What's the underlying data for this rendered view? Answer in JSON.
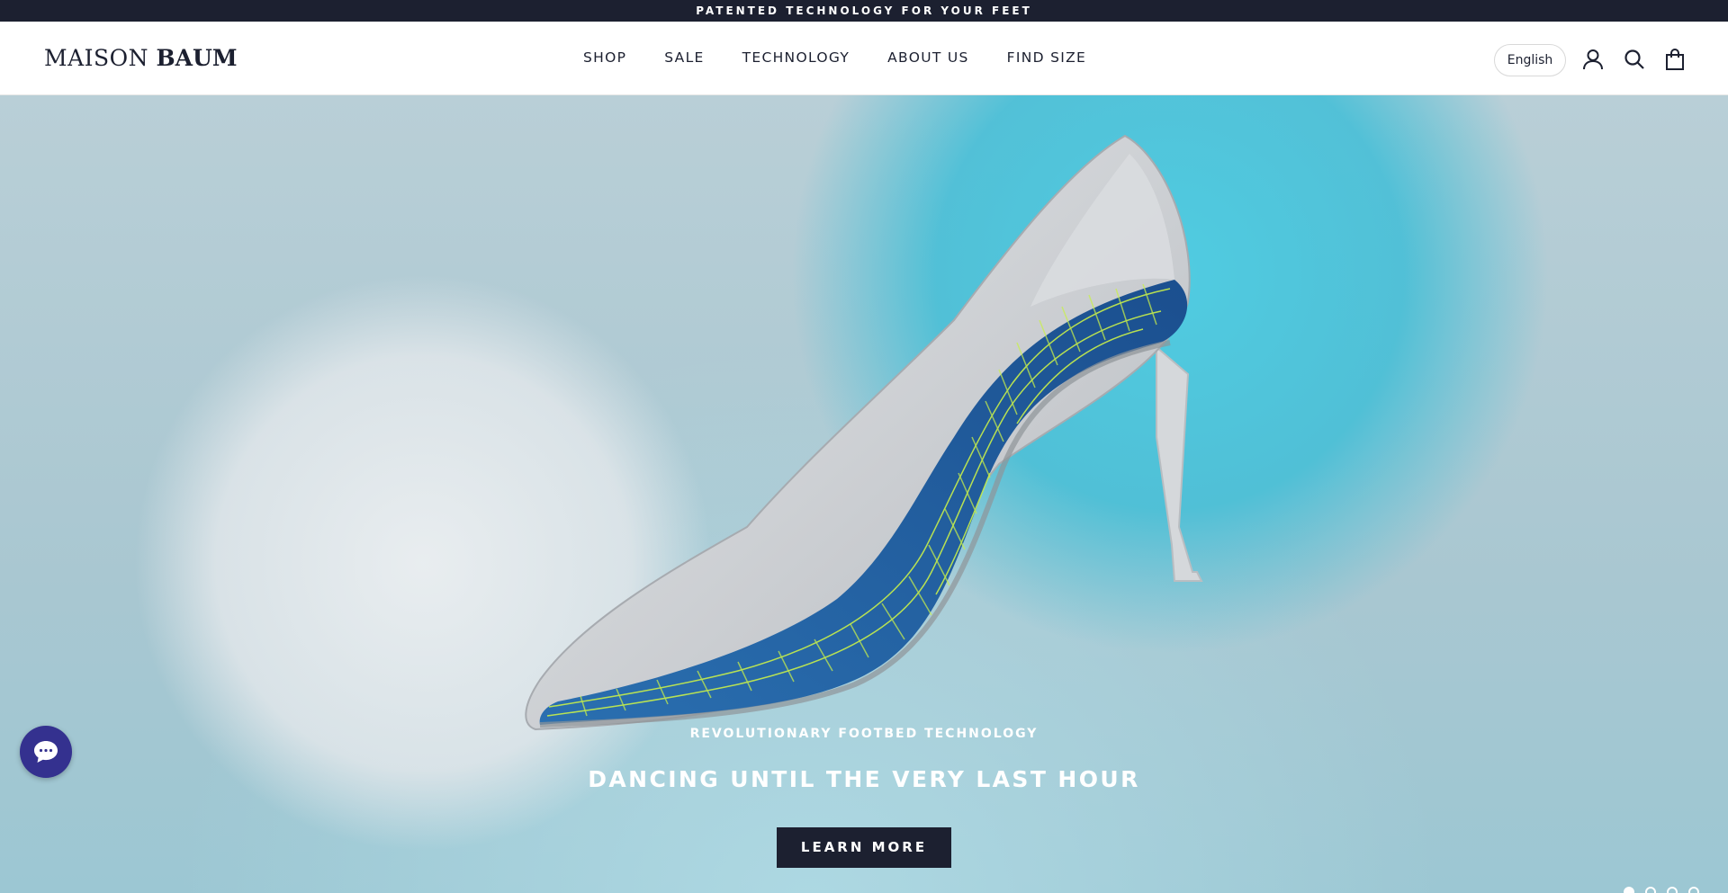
{
  "announcement": "PATENTED TECHNOLOGY FOR YOUR FEET",
  "header": {
    "logo_regular": "MAISON ",
    "logo_bold": "BAUM",
    "nav": [
      {
        "label": "SHOP"
      },
      {
        "label": "SALE"
      },
      {
        "label": "TECHNOLOGY"
      },
      {
        "label": "ABOUT US"
      },
      {
        "label": "FIND SIZE"
      }
    ],
    "language": "English",
    "icons": [
      "account-icon",
      "search-icon",
      "cart-icon"
    ]
  },
  "hero": {
    "eyebrow": "REVOLUTIONARY FOOTBED TECHNOLOGY",
    "headline": "DANCING UNTIL THE VERY LAST HOUR",
    "cta": "LEARN MORE",
    "slides_total": 4,
    "slide_active": 1
  },
  "colors": {
    "navy": "#1c2030",
    "chat": "#34318f",
    "footbed_blue": "#1f5aa0",
    "mesh_green": "#c9f04a"
  }
}
